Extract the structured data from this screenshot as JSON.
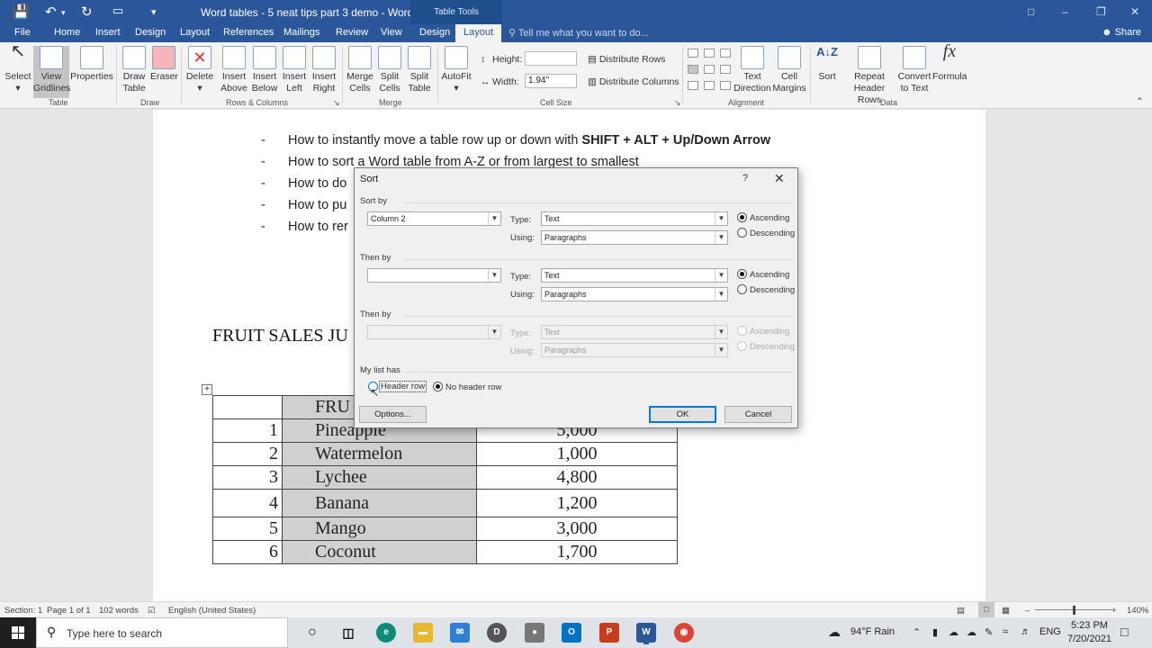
{
  "window": {
    "title": "Word tables - 5 neat tips part 3 demo - Word",
    "context_tab": "Table Tools"
  },
  "menu": {
    "tabs": [
      "File",
      "Home",
      "Insert",
      "Design",
      "Layout",
      "References",
      "Mailings",
      "Review",
      "View",
      "Design",
      "Layout"
    ],
    "active_tab": "Layout",
    "tell_me": "Tell me what you want to do...",
    "share": "Share"
  },
  "ribbon": {
    "table": {
      "select": "Select",
      "view_gridlines": "View Gridlines",
      "properties": "Properties",
      "group": "Table"
    },
    "draw": {
      "draw_table": "Draw Table",
      "eraser": "Eraser",
      "group": "Draw"
    },
    "rows_columns": {
      "delete": "Delete",
      "insert_above": "Insert Above",
      "insert_below": "Insert Below",
      "insert_left": "Insert Left",
      "insert_right": "Insert Right",
      "group": "Rows & Columns"
    },
    "merge": {
      "merge_cells": "Merge Cells",
      "split_cells": "Split Cells",
      "split_table": "Split Table",
      "group": "Merge"
    },
    "cell_size": {
      "autofit": "AutoFit",
      "height_label": "Height:",
      "height_value": "",
      "width_label": "Width:",
      "width_value": "1.94\"",
      "distribute_rows": "Distribute Rows",
      "distribute_columns": "Distribute Columns",
      "group": "Cell Size"
    },
    "alignment": {
      "text_direction": "Text Direction",
      "cell_margins": "Cell Margins",
      "group": "Alignment"
    },
    "data": {
      "sort": "Sort",
      "repeat_header_rows": "Repeat Header Rows",
      "convert_to_text": "Convert to Text",
      "formula": "Formula",
      "group": "Data"
    }
  },
  "document": {
    "bullets": [
      {
        "dash": "-",
        "text": "How to instantly move a table row up or down with ",
        "bold": "SHIFT + ALT + Up/Down Arrow"
      },
      {
        "dash": "-",
        "text": "How to sort a Word table from A-Z or from largest to smallest",
        "bold": ""
      },
      {
        "dash": "-",
        "text": "How to do",
        "bold": ""
      },
      {
        "dash": "-",
        "text": "How to pu",
        "bold": ""
      },
      {
        "dash": "-",
        "text": "How to rer",
        "bold": ""
      }
    ],
    "heading": "FRUIT SALES JU",
    "table": {
      "header": [
        "",
        "FRU",
        ""
      ],
      "rows": [
        [
          "1",
          "Pineapple",
          "5,000"
        ],
        [
          "2",
          "Watermelon",
          "1,000"
        ],
        [
          "3",
          "Lychee",
          "4,800"
        ],
        [
          "4",
          "Banana",
          "1,200"
        ],
        [
          "5",
          "Mango",
          "3,000"
        ],
        [
          "6",
          "Coconut",
          "1,700"
        ]
      ]
    }
  },
  "sort_dialog": {
    "title": "Sort",
    "help": "?",
    "close": "✕",
    "sort_by": {
      "label": "Sort by",
      "field": "Column 2",
      "type_label": "Type:",
      "type": "Text",
      "using_label": "Using:",
      "using": "Paragraphs",
      "ascending": "Ascending",
      "descending": "Descending",
      "selected": "ascending"
    },
    "then_by_1": {
      "label": "Then by",
      "field": "",
      "type_label": "Type:",
      "type": "Text",
      "using_label": "Using:",
      "using": "Paragraphs",
      "ascending": "Ascending",
      "descending": "Descending",
      "selected": "ascending"
    },
    "then_by_2": {
      "label": "Then by",
      "field": "",
      "type_label": "Type:",
      "type": "Text",
      "using_label": "Using:",
      "using": "Paragraphs",
      "ascending": "Ascending",
      "descending": "Descending",
      "disabled": true
    },
    "list_has": {
      "label": "My list has",
      "header_row": "Header row",
      "no_header_row": "No header row",
      "selected": "no_header_row"
    },
    "buttons": {
      "options": "Options...",
      "ok": "OK",
      "cancel": "Cancel"
    }
  },
  "status": {
    "section": "Section: 1",
    "page": "Page 1 of 1",
    "words": "102 words",
    "language": "English (United States)",
    "zoom": "140%"
  },
  "taskbar": {
    "search_placeholder": "Type here to search",
    "weather": "94°F Rain",
    "lang": "ENG",
    "time": "5:23 PM",
    "date": "7/20/2021"
  },
  "colors": {
    "word_blue": "#2b579a",
    "tab_dark": "#1f4e8c",
    "cell_shade": "#d0d0d0",
    "dialog_bg": "#f0f0f0"
  }
}
